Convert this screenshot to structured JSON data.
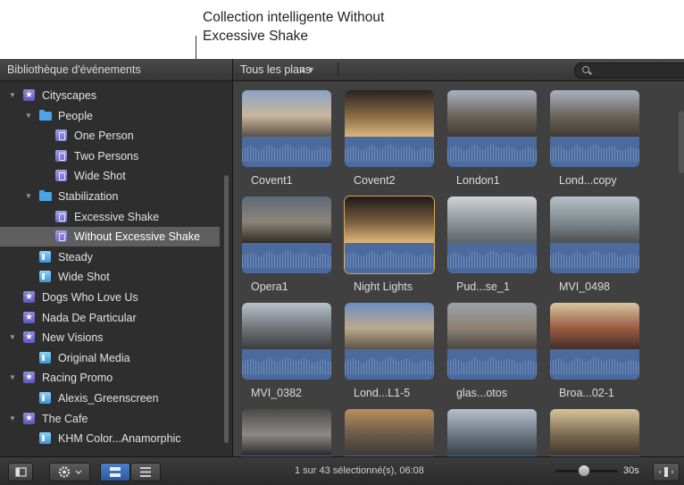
{
  "callout": {
    "line1": "Collection intelligente Without",
    "line2": "Excessive Shake"
  },
  "sidebar": {
    "title": "Bibliothèque d'événements",
    "items": [
      {
        "label": "Cityscapes",
        "icon": "star-event-icon",
        "expanded": true
      },
      {
        "label": "People",
        "icon": "folder-icon",
        "expanded": true
      },
      {
        "label": "One Person",
        "icon": "smart-collection-icon"
      },
      {
        "label": "Two Persons",
        "icon": "smart-collection-icon"
      },
      {
        "label": "Wide Shot",
        "icon": "smart-collection-icon"
      },
      {
        "label": "Stabilization",
        "icon": "folder-icon",
        "expanded": true
      },
      {
        "label": "Excessive Shake",
        "icon": "smart-collection-icon"
      },
      {
        "label": "Without Excessive Shake",
        "icon": "smart-collection-icon",
        "selected": true
      },
      {
        "label": "Steady",
        "icon": "keyword-collection-icon"
      },
      {
        "label": "Wide Shot",
        "icon": "keyword-collection-icon"
      },
      {
        "label": "Dogs Who Love Us",
        "icon": "star-event-icon"
      },
      {
        "label": "Nada De Particular",
        "icon": "star-event-icon"
      },
      {
        "label": "New Visions",
        "icon": "star-event-icon",
        "expanded": true
      },
      {
        "label": "Original Media",
        "icon": "keyword-collection-icon"
      },
      {
        "label": "Racing Promo",
        "icon": "star-event-icon",
        "expanded": true
      },
      {
        "label": "Alexis_Greenscreen",
        "icon": "keyword-collection-icon"
      },
      {
        "label": "The Cafe",
        "icon": "star-event-icon",
        "expanded": true
      },
      {
        "label": "KHM Color...Anamorphic",
        "icon": "keyword-collection-icon"
      }
    ]
  },
  "browser": {
    "filter": "Tous les plans",
    "clips": [
      {
        "name": "Covent1",
        "colors": [
          "#8aa3c6",
          "#c9b79a",
          "#5a5148"
        ]
      },
      {
        "name": "Covent2",
        "colors": [
          "#2a2320",
          "#8a6a45",
          "#d9b77a"
        ]
      },
      {
        "name": "London1",
        "colors": [
          "#a7b3c2",
          "#6c6459",
          "#3f3a35"
        ]
      },
      {
        "name": "Lond...copy",
        "colors": [
          "#a7b3c2",
          "#6c6459",
          "#3f3a35"
        ]
      },
      {
        "name": "Opera1",
        "colors": [
          "#5c6a7a",
          "#8d8477",
          "#2f2b27"
        ]
      },
      {
        "name": "Night Lights",
        "colors": [
          "#1d1a18",
          "#7a5d3d",
          "#e0b879"
        ],
        "selected": true
      },
      {
        "name": "Pud...se_1",
        "colors": [
          "#cfd3d6",
          "#8e9497",
          "#5e6467"
        ]
      },
      {
        "name": "MVI_0498",
        "colors": [
          "#b5c0c8",
          "#7f8a8e",
          "#4a5054"
        ]
      },
      {
        "name": "MVI_0382",
        "colors": [
          "#b9c3cc",
          "#6f7378",
          "#3b3d40"
        ]
      },
      {
        "name": "Lond...L1-5",
        "colors": [
          "#6b8fc2",
          "#bcaa8c",
          "#5d5246"
        ]
      },
      {
        "name": "glas...otos",
        "colors": [
          "#9aa3aa",
          "#8d8172",
          "#4b4640"
        ]
      },
      {
        "name": "Broa...02-1",
        "colors": [
          "#d8c6a0",
          "#9a5a42",
          "#3e2f28"
        ]
      },
      {
        "name": "",
        "colors": [
          "#4b4a48",
          "#8b8a86",
          "#2a2a2a"
        ]
      },
      {
        "name": "",
        "colors": [
          "#b98e5b",
          "#6a5a4a",
          "#3f3a35"
        ]
      },
      {
        "name": "",
        "colors": [
          "#b4c0cc",
          "#6c7782",
          "#3a4048"
        ]
      },
      {
        "name": "",
        "colors": [
          "#d8c49a",
          "#7a6a52",
          "#3f352b"
        ]
      }
    ]
  },
  "toolbar": {
    "status": "1 sur 43 sélectionné(s), 06:08",
    "duration": "30s"
  }
}
